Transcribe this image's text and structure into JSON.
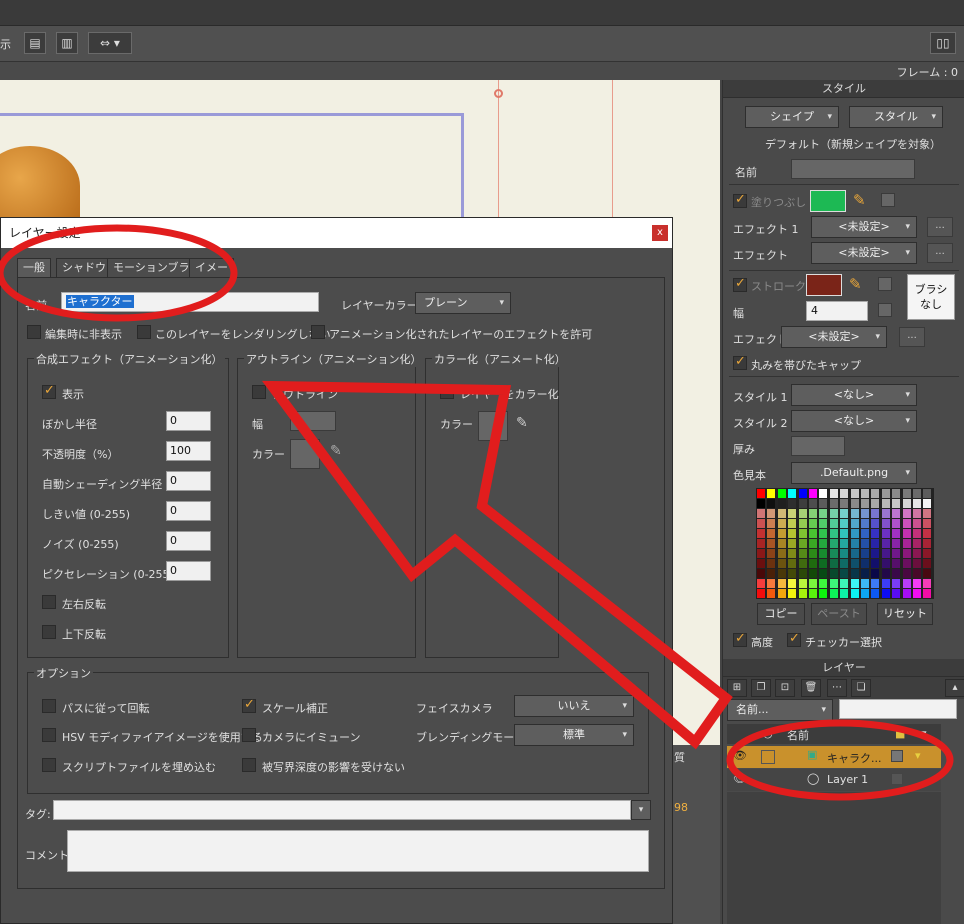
{
  "toolbar": {
    "partial_label": "示",
    "frame_label": "フレーム : 0"
  },
  "style_panel": {
    "title": "スタイル",
    "shape_btn": "シェイプ",
    "style_btn": "スタイル",
    "default_label": "デフォルト（新規シェイプを対象）",
    "name_label": "名前",
    "fill_label": "塗りつぶし",
    "fill_color": "#1db954",
    "effect1_label": "エフェクト 1",
    "effect1_value": "<未設定>",
    "effect_label": "エフェクト",
    "effect_value": "<未設定>",
    "stroke_label": "ストローク",
    "stroke_color": "#7a2418",
    "brush_label": "ブラシ\nなし",
    "width_label": "幅",
    "width_value": "4",
    "effect2_label": "エフェクト",
    "effect2_value": "<未設定>",
    "cap_label": "丸みを帯びたキャップ",
    "style1_label": "スタイル 1",
    "style1_value": "<なし>",
    "style2_label": "スタイル 2",
    "style2_value": "<なし>",
    "thickness_label": "厚み",
    "swatch_label": "色見本",
    "swatch_value": ".Default.png",
    "copy_btn": "コピー",
    "paste_btn": "ペースト",
    "reset_btn": "リセット",
    "advanced_label": "高度",
    "checker_label": "チェッカー選択"
  },
  "layer_panel": {
    "title": "レイヤー",
    "name_dropdown": "名前...",
    "col_name": "名前",
    "rows": [
      {
        "name": "キャラク..."
      },
      {
        "name": "Layer 1"
      }
    ]
  },
  "dialog": {
    "title": "レイヤー設定",
    "close": "x",
    "tabs": [
      "一般",
      "シャドウ",
      "モーションブラー",
      "イメー"
    ],
    "name_label": "名前",
    "name_value": "キャラクター",
    "layer_color_label": "レイヤーカラー",
    "layer_color_value": "プレーン",
    "check_hidden": "編集時に非表示",
    "check_no_render": "このレイヤーをレンダリングしない",
    "check_anim_effects": "アニメーション化されたレイヤーのエフェクトを許可",
    "comp_title": "合成エフェクト（アニメーション化）",
    "show_label": "表示",
    "comp_rows": [
      {
        "label": "ぼかし半径",
        "value": "0"
      },
      {
        "label": "不透明度（%）",
        "value": "100"
      },
      {
        "label": "自動シェーディング半径",
        "value": "0"
      },
      {
        "label": "しきい値 (0-255)",
        "value": "0"
      },
      {
        "label": "ノイズ (0-255)",
        "value": "0"
      },
      {
        "label": "ピクセレーション (0-255)",
        "value": "0"
      }
    ],
    "flip_h": "左右反転",
    "flip_v": "上下反転",
    "outline_title": "アウトライン（アニメーション化）",
    "outline_check": "アウトライン",
    "outline_width": "幅",
    "outline_color": "カラー",
    "colorize_title": "カラー化（アニメート化）",
    "colorize_check": "レイヤーをカラー化",
    "colorize_color": "カラー",
    "options_title": "オプション",
    "opt_path_rotate": "パスに従って回転",
    "opt_scale": "スケール補正",
    "opt_face_camera": "フェイスカメラ",
    "opt_face_value": "いいえ",
    "opt_hsv": "HSV モディファイアイメージを使用する",
    "opt_immune": "カメラにイミューン",
    "opt_blend": "ブレンディングモード",
    "opt_blend_value": "標準",
    "opt_embed": "スクリプトファイルを埋め込む",
    "opt_dof": "被写界深度の影響を受けない",
    "tag_label": "タグ:",
    "comment_label": "コメント:"
  },
  "timeline_partial": {
    "quality_label": "質",
    "frame_num": "98"
  }
}
